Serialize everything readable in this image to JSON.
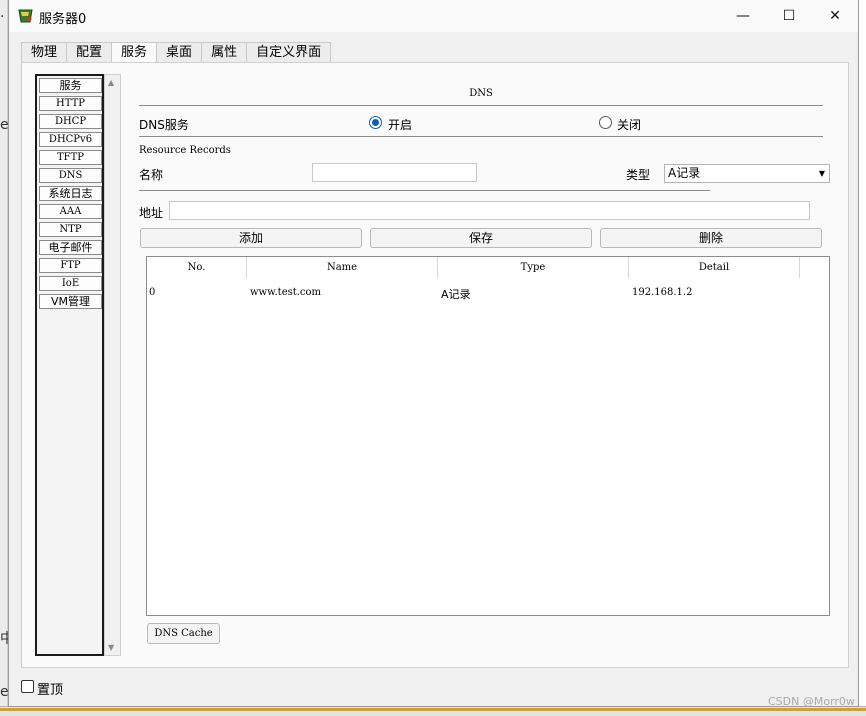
{
  "background": {
    "glyph_1": ".",
    "glyph_2": "e",
    "glyph_3": "中",
    "glyph_4": "e"
  },
  "window": {
    "title": "服务器0",
    "controls": {
      "minimize": "—",
      "maximize": "☐",
      "close": "✕"
    }
  },
  "tabs": [
    {
      "label": "物理"
    },
    {
      "label": "配置"
    },
    {
      "label": "服务",
      "active": true
    },
    {
      "label": "桌面"
    },
    {
      "label": "属性"
    },
    {
      "label": "自定义界面"
    }
  ],
  "services": [
    "服务",
    "HTTP",
    "DHCP",
    "DHCPv6",
    "TFTP",
    "DNS",
    "系统日志",
    "AAA",
    "NTP",
    "电子邮件",
    "FTP",
    "IoE",
    "VM管理"
  ],
  "dns": {
    "title": "DNS",
    "service_label": "DNS服务",
    "on_label": "开启",
    "off_label": "关闭",
    "service_on": true,
    "resource_records_label": "Resource Records",
    "name_label": "名称",
    "name_value": "",
    "type_label": "类型",
    "type_value": "A记录",
    "address_label": "地址",
    "address_value": "",
    "buttons": {
      "add": "添加",
      "save": "保存",
      "delete": "删除"
    },
    "table": {
      "headers": [
        "No.",
        "Name",
        "Type",
        "Detail"
      ],
      "rows": [
        {
          "no": "0",
          "name": "www.test.com",
          "type": "A记录",
          "detail": "192.168.1.2"
        }
      ]
    },
    "cache_button": "DNS Cache"
  },
  "footer": {
    "pin_label": "置顶",
    "pin_checked": false
  },
  "watermark": "CSDN @Morr0w",
  "colors": {
    "radio_accent": "#0a5fb4",
    "bottom_bar": "#c8a23a"
  }
}
